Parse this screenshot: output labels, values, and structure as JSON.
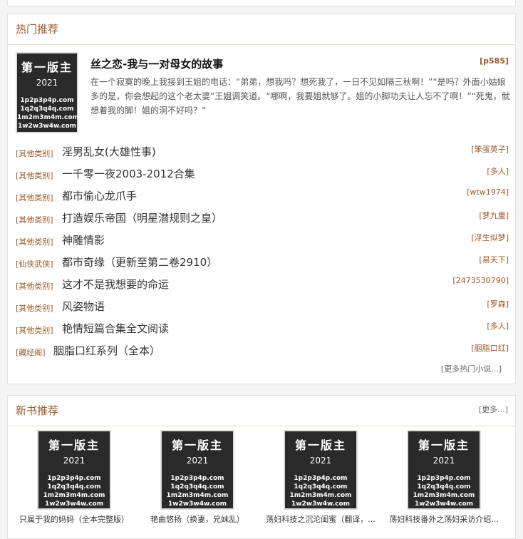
{
  "hot": {
    "heading": "热门推荐",
    "feature": {
      "title": "丝之恋-我与一对母女的故事",
      "pages": "[p585]",
      "description": "在一个寂寞的晚上我接到王姐的电话：“弟弟，想我吗？想死我了，一日不见如隔三秋啊！”“是吗？外面小姑娘多的是，你会想起的这个老太婆”王姐调笑道。“哪啊，我要姐就够了。姐的小脚功夫让人忘不了啊！”“死鬼，就想着我的脚！姐的洞不好吗？”"
    },
    "items": [
      {
        "category": "[其他类别]",
        "title": "淫男乱女(大雄性事)",
        "author": "[笨蛋英子]"
      },
      {
        "category": "[其他类别]",
        "title": "一千零一夜2003-2012合集",
        "author": "[多人]"
      },
      {
        "category": "[其他类别]",
        "title": "都市偷心龙爪手",
        "author": "[wtw1974]"
      },
      {
        "category": "[其他类别]",
        "title": "打造娱乐帝国（明星潜规则之皇）",
        "author": "[梦九重]"
      },
      {
        "category": "[其他类别]",
        "title": "神雕情影",
        "author": "[浮生似梦]"
      },
      {
        "category": "[仙侠武侠]",
        "title": "都市奇缘（更新至第二卷2910）",
        "author": "[易天下]"
      },
      {
        "category": "[其他类别]",
        "title": "这才不是我想要的命运",
        "author": "[2473530790]"
      },
      {
        "category": "[其他类别]",
        "title": "风姿物语",
        "author": "[罗森]"
      },
      {
        "category": "[其他类别]",
        "title": "艳情短篇合集全文阅读",
        "author": "[多人]"
      },
      {
        "category": "[藏经阁]",
        "title": "胭脂口红系列（全本）",
        "author": "[胭脂口红]"
      }
    ],
    "more_label": "[更多热门小说...]"
  },
  "cover": {
    "logo": "第一版主",
    "year": "2021",
    "lines": [
      "1p2p3p4p.com",
      "1q2q3q4q.com",
      "1m2m3m4m.com",
      "1w2w3w4w.com"
    ]
  },
  "newbooks": {
    "heading": "新书推荐",
    "more_label": "[更多...]",
    "books": [
      {
        "title": "只属于我的妈妈（全本完整版）"
      },
      {
        "title": "艳曲悠扬（换妻，兄妹乱）"
      },
      {
        "title": "荡妇科技之沉沦闺蜜（翻译，..."
      },
      {
        "title": "荡妇科技番外之荡妇采访介绍..."
      }
    ]
  },
  "colors": {
    "accent": "#9b5a2b",
    "cover_bg": "#2a2a2a"
  }
}
